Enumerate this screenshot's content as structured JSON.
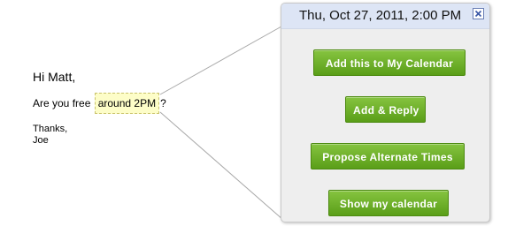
{
  "email": {
    "greeting": "Hi Matt,",
    "question_before": "Are you free ",
    "highlight": "around 2PM",
    "question_after": "?",
    "thanks": "Thanks,",
    "signature": "Joe"
  },
  "popup": {
    "title": "Thu, Oct 27, 2011, 2:00 PM",
    "close_icon": "close-icon",
    "buttons": {
      "add_calendar": "Add this to My Calendar",
      "add_reply": "Add & Reply",
      "propose": "Propose Alternate Times",
      "show_calendar": "Show my calendar"
    }
  },
  "colors": {
    "button_green": "#6aae24",
    "header_blue": "#dde5f5",
    "highlight_yellow": "#fdfdc8"
  }
}
